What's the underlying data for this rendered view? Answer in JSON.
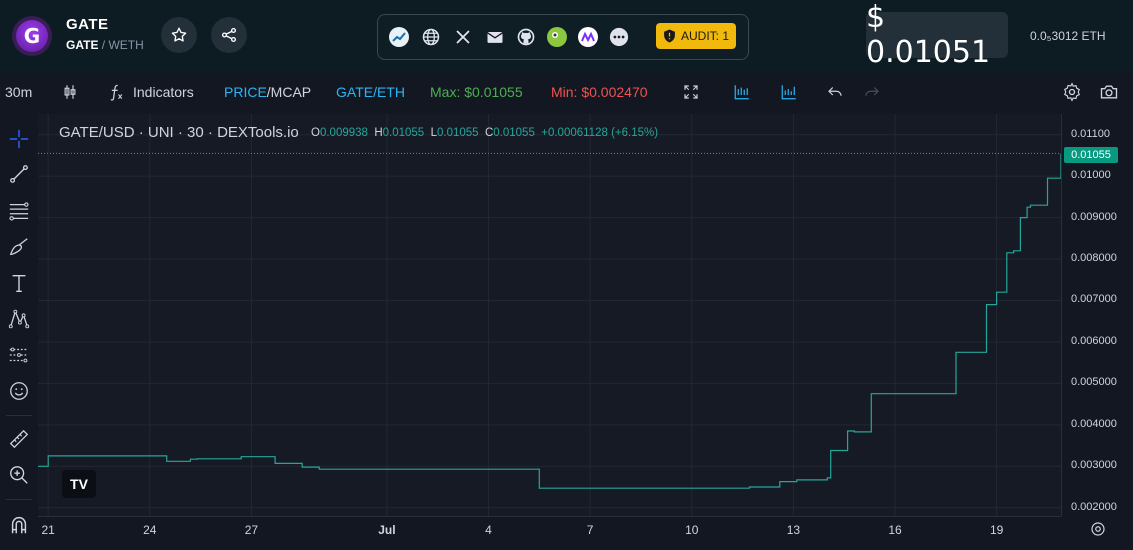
{
  "header": {
    "logo_letter": "G",
    "token_name": "GATE",
    "pair_base": "GATE",
    "pair_sep": " / ",
    "pair_quote": "WETH",
    "audit_label": "AUDIT: 1",
    "price_usd": "$ 0.01051",
    "price_eth": "0.0₅3012  ETH",
    "icons": [
      "star-icon",
      "share-icon",
      "dextools-icon",
      "globe-icon",
      "x-icon",
      "mail-icon",
      "github-icon",
      "coingecko-icon",
      "coinmarketcap-icon",
      "more-icon",
      "shield-icon"
    ]
  },
  "toolbar": {
    "interval": "30m",
    "indicators": "Indicators",
    "price_label": "PRICE",
    "mcap_label": "/MCAP",
    "pair_toggle": "GATE/ETH",
    "max_label": "Max: $0.01055",
    "min_label": "Min: $0.002470",
    "colors": {
      "price": "#29b6f6",
      "max": "#4caf50",
      "min": "#ef5350"
    }
  },
  "legend": {
    "title": "GATE/USD · UNI · 30 · DEXTools.io",
    "o_label": "O",
    "o_value": "0.009938",
    "h_label": "H",
    "h_value": "0.01055",
    "l_label": "L",
    "l_value": "0.01055",
    "c_label": "C",
    "c_value": "0.01055",
    "change": "+0.00061128 (+6.15%)"
  },
  "current_price_tag": "0.01055",
  "chart_data": {
    "type": "line",
    "title": "GATE/USD · UNI · 30 · DEXTools.io",
    "x_ticks": [
      "21",
      "24",
      "27",
      "Jul",
      "4",
      "7",
      "10",
      "13",
      "16",
      "19"
    ],
    "y_ticks": [
      "0.01100",
      "0.01000",
      "0.009000",
      "0.008000",
      "0.007000",
      "0.006000",
      "0.005000",
      "0.004000",
      "0.003000",
      "0.002000"
    ],
    "ylim": [
      0.0018,
      0.0115
    ],
    "x_range_days": [
      20.7,
      50.9
    ],
    "series": [
      {
        "color": "#26a69a",
        "x": [
          20.7,
          20.9,
          21.0,
          24.4,
          24.5,
          25.2,
          25.4,
          26.6,
          26.7,
          27.6,
          27.7,
          28.4,
          28.5,
          29.0,
          35.4,
          35.5,
          41.2,
          41.7,
          42.6,
          43.1,
          43.5,
          44.0,
          44.1,
          44.5,
          44.6,
          44.8,
          45.2,
          45.3,
          47.7,
          47.8,
          48.6,
          48.7,
          48.9,
          49.0,
          49.3,
          49.5,
          49.7,
          49.9,
          50.0,
          50.2,
          50.5,
          50.8,
          50.9
        ],
        "y": [
          0.003,
          0.003,
          0.00325,
          0.00325,
          0.00312,
          0.00317,
          0.00318,
          0.00318,
          0.00323,
          0.00323,
          0.00307,
          0.00307,
          0.00298,
          0.00293,
          0.00293,
          0.00247,
          0.00247,
          0.0025,
          0.00263,
          0.00267,
          0.00267,
          0.00272,
          0.00338,
          0.00338,
          0.00385,
          0.00383,
          0.00383,
          0.00475,
          0.00475,
          0.00575,
          0.00575,
          0.0069,
          0.0069,
          0.0072,
          0.00815,
          0.0082,
          0.009,
          0.00925,
          0.0093,
          0.0093,
          0.00995,
          0.00995,
          0.01055
        ]
      }
    ],
    "grid": true,
    "legend": "none"
  },
  "sidebar_tools": [
    "crosshair-icon",
    "trend-line-icon",
    "fib-icon",
    "brush-icon",
    "text-icon",
    "pattern-icon",
    "prediction-icon",
    "emoji-icon",
    "ruler-icon",
    "zoom-in-icon",
    "magnet-icon"
  ]
}
